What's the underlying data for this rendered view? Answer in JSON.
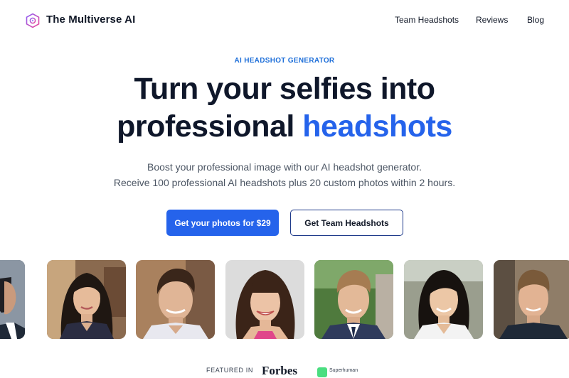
{
  "header": {
    "brand": "The Multiverse AI",
    "nav": [
      "Team Headshots",
      "Reviews",
      "Blog"
    ]
  },
  "hero": {
    "eyebrow": "AI HEADSHOT GENERATOR",
    "title_line1": "Turn your selfies into",
    "title_line2_plain": "professional ",
    "title_line2_accent": "headshots",
    "subtitle_line1": "Boost your professional image with our AI headshot generator.",
    "subtitle_line2": "Receive 100 professional AI headshots plus 20 custom photos within 2 hours."
  },
  "actions": {
    "primary": "Get your photos for $29",
    "secondary": "Get Team Headshots"
  },
  "featured": {
    "label": "FEATURED IN",
    "logos": [
      "Forbes",
      "Superhuman"
    ]
  },
  "colors": {
    "accent": "#2563eb",
    "heading": "#0f172a",
    "eyebrow": "#1e6fd9",
    "body_text": "#4b5563"
  },
  "icons": {
    "brand_logo": "hexagon-logo-icon"
  }
}
